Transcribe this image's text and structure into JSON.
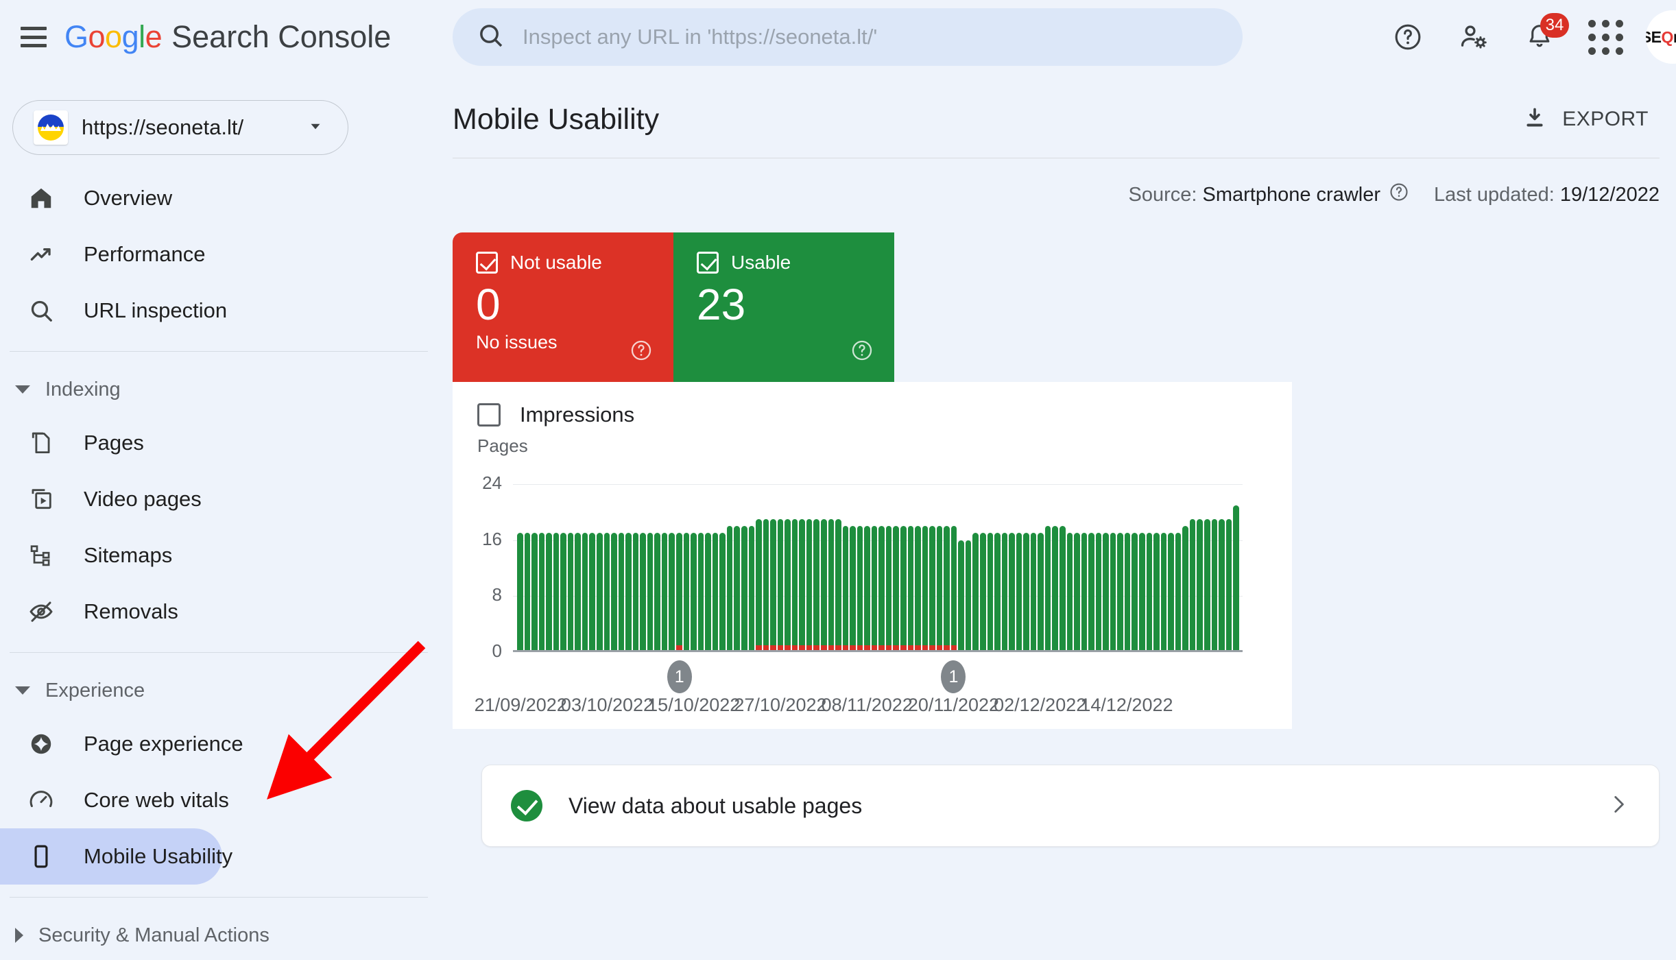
{
  "header": {
    "menu_icon": "hamburger-menu-icon",
    "brand_google": "Google",
    "brand_product": "Search Console",
    "search_placeholder": "Inspect any URL in 'https://seoneta.lt/'",
    "search_value": "",
    "search_icon": "search-icon",
    "help_icon": "help-circle-icon",
    "account_settings_icon": "person-gear-icon",
    "notifications_icon": "bell-icon",
    "notifications_count": "34",
    "apps_icon": "grid-apps-icon",
    "avatar_text": "SEOneta",
    "avatar_letters_1": "SE",
    "avatar_letters_2": "neta"
  },
  "sidebar": {
    "property_url": "https://seoneta.lt/",
    "property_caret_icon": "chevron-down-icon",
    "items": [
      {
        "label": "Overview",
        "icon": "home-icon",
        "active": false
      },
      {
        "label": "Performance",
        "icon": "trending-up-icon",
        "active": false
      },
      {
        "label": "URL inspection",
        "icon": "search-icon",
        "active": false
      }
    ],
    "groups": [
      {
        "label": "Indexing",
        "expanded": true,
        "items": [
          {
            "label": "Pages",
            "icon": "pages-copy-icon",
            "active": false
          },
          {
            "label": "Video pages",
            "icon": "video-pages-icon",
            "active": false
          },
          {
            "label": "Sitemaps",
            "icon": "sitemap-tree-icon",
            "active": false
          },
          {
            "label": "Removals",
            "icon": "eye-off-icon",
            "active": false
          }
        ]
      },
      {
        "label": "Experience",
        "expanded": true,
        "items": [
          {
            "label": "Page experience",
            "icon": "sparkle-circle-icon",
            "active": false
          },
          {
            "label": "Core web vitals",
            "icon": "gauge-icon",
            "active": false
          },
          {
            "label": "Mobile Usability",
            "icon": "mobile-phone-icon",
            "active": true
          }
        ]
      },
      {
        "label": "Security & Manual Actions",
        "expanded": false,
        "items": []
      }
    ]
  },
  "main": {
    "page_title": "Mobile Usability",
    "export_label": "EXPORT",
    "export_icon": "download-icon",
    "source_prefix": "Source:",
    "source_value": "Smartphone crawler",
    "source_help_icon": "help-circle-icon",
    "last_updated_prefix": "Last updated:",
    "last_updated_value": "19/12/2022",
    "cards": [
      {
        "label": "Not usable",
        "value": "0",
        "sub": "No issues",
        "color": "#dc3226",
        "checked": true,
        "help_icon": "help-circle-icon"
      },
      {
        "label": "Usable",
        "value": "23",
        "sub": "",
        "color": "#1e8e3e",
        "checked": true,
        "help_icon": "help-circle-icon"
      }
    ],
    "impressions_label": "Impressions",
    "impressions_checked": false,
    "bottom_card": {
      "label": "View data about usable pages",
      "status_icon": "check-circle-icon",
      "chevron_icon": "chevron-right-icon"
    }
  },
  "chart_data": {
    "type": "bar",
    "title": "",
    "ylabel": "Pages",
    "xlabel": "",
    "ylim": [
      0,
      24
    ],
    "yticks": [
      0,
      8,
      16,
      24
    ],
    "grid": true,
    "legend": [
      "Usable",
      "Not usable"
    ],
    "legend_position": "none",
    "colors": {
      "usable": "#1e8e3e",
      "not_usable": "#d93025"
    },
    "xtick_labels": [
      "21/09/2022",
      "03/10/2022",
      "15/10/2022",
      "27/10/2022",
      "08/11/2022",
      "20/11/2022",
      "02/12/2022",
      "14/12/2022"
    ],
    "xtick_positions": [
      0,
      12,
      24,
      36,
      48,
      60,
      72,
      84
    ],
    "annotations": [
      {
        "label": "1",
        "index": 22
      },
      {
        "label": "1",
        "index": 60
      }
    ],
    "series": [
      {
        "name": "Usable",
        "values": [
          17,
          17,
          17,
          17,
          17,
          17,
          17,
          17,
          17,
          17,
          17,
          17,
          17,
          17,
          17,
          17,
          17,
          17,
          17,
          17,
          17,
          17,
          16,
          17,
          17,
          17,
          17,
          17,
          17,
          18,
          18,
          18,
          18,
          18,
          18,
          18,
          18,
          18,
          18,
          18,
          18,
          18,
          18,
          18,
          18,
          17,
          17,
          17,
          17,
          17,
          17,
          17,
          17,
          17,
          17,
          17,
          17,
          17,
          17,
          17,
          17,
          16,
          16,
          17,
          17,
          17,
          17,
          17,
          17,
          17,
          17,
          17,
          17,
          18,
          18,
          18,
          17,
          17,
          17,
          17,
          17,
          17,
          17,
          17,
          17,
          17,
          17,
          17,
          17,
          17,
          17,
          17,
          18,
          19,
          19,
          19,
          19,
          19,
          19,
          21
        ]
      },
      {
        "name": "Not usable",
        "values": [
          0,
          0,
          0,
          0,
          0,
          0,
          0,
          0,
          0,
          0,
          0,
          0,
          0,
          0,
          0,
          0,
          0,
          0,
          0,
          0,
          0,
          0,
          1,
          0,
          0,
          0,
          0,
          0,
          0,
          0,
          0,
          0,
          0,
          1,
          1,
          1,
          1,
          1,
          1,
          1,
          1,
          1,
          1,
          1,
          1,
          1,
          1,
          1,
          1,
          1,
          1,
          1,
          1,
          1,
          1,
          1,
          1,
          1,
          1,
          1,
          1,
          0,
          0,
          0,
          0,
          0,
          0,
          0,
          0,
          0,
          0,
          0,
          0,
          0,
          0,
          0,
          0,
          0,
          0,
          0,
          0,
          0,
          0,
          0,
          0,
          0,
          0,
          0,
          0,
          0,
          0,
          0,
          0,
          0,
          0,
          0,
          0,
          0,
          0,
          0
        ]
      }
    ]
  }
}
